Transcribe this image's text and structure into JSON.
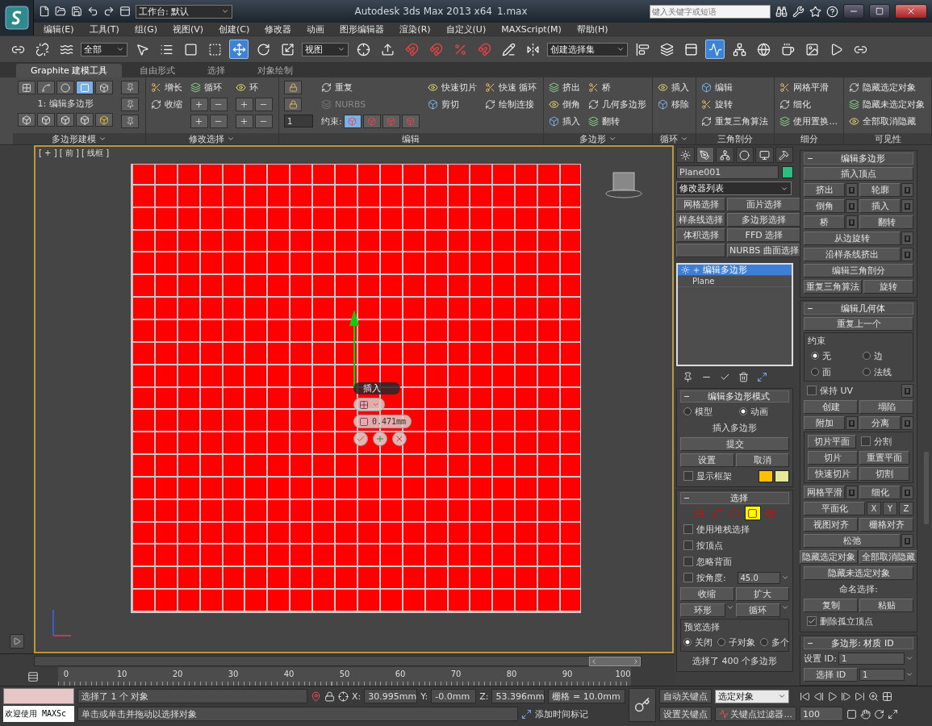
{
  "title_bar": {
    "workspace": "工作台: 默认",
    "title": "Autodesk 3ds Max  2013 x64",
    "file": "1.max",
    "search": {
      "placeholder": "键入关键字或短语"
    }
  },
  "menu": [
    "编辑(E)",
    "工具(T)",
    "组(G)",
    "视图(V)",
    "创建(C)",
    "修改器",
    "动画",
    "图形编辑器",
    "渲染(R)",
    "自定义(U)",
    "MAXScript(M)",
    "帮助(H)"
  ],
  "toolbar": [
    {
      "kind": "tool",
      "active": false
    },
    {
      "kind": "tool",
      "active": false
    },
    {
      "kind": "tool",
      "active": false
    },
    {
      "kind": "dropdown",
      "label": "全部"
    },
    {
      "kind": "tool",
      "active": false
    },
    {
      "kind": "tool",
      "active": false
    },
    {
      "kind": "tool",
      "active": false
    },
    {
      "kind": "tool",
      "active": false
    },
    {
      "kind": "tool",
      "active": true
    },
    {
      "kind": "tool",
      "active": false
    },
    {
      "kind": "tool",
      "active": false
    },
    {
      "kind": "dropdown",
      "label": "视图"
    },
    {
      "kind": "tool",
      "active": false
    },
    {
      "kind": "tool",
      "active": false
    },
    {
      "kind": "tool",
      "active": false
    },
    {
      "kind": "tool",
      "active": false
    },
    {
      "kind": "tool",
      "active": false
    },
    {
      "kind": "tool",
      "active": false
    },
    {
      "kind": "tool",
      "active": false
    },
    {
      "kind": "tool",
      "active": false
    },
    {
      "kind": "dropdown",
      "label": "创建选择集"
    },
    {
      "kind": "tool",
      "active": false
    },
    {
      "kind": "tool",
      "active": false
    },
    {
      "kind": "tool",
      "active": false
    },
    {
      "kind": "tool",
      "active": true
    },
    {
      "kind": "tool",
      "active": false
    },
    {
      "kind": "tool",
      "active": false
    },
    {
      "kind": "tool",
      "active": false
    },
    {
      "kind": "tool",
      "active": false
    },
    {
      "kind": "tool",
      "active": false
    },
    {
      "kind": "tool",
      "active": false
    }
  ],
  "ribbon": {
    "tabs": [
      {
        "label": "Graphite 建模工具",
        "selected": true
      },
      {
        "label": "自由形式",
        "selected": false
      },
      {
        "label": "选择",
        "selected": false
      },
      {
        "label": "对象绘制",
        "selected": false
      }
    ],
    "groups": [
      {
        "title": "多边形建模",
        "dropdown": true,
        "kind": "modeling",
        "caption": "1: 编辑多边形",
        "levels": [
          {
            "selected": false
          },
          {
            "selected": false
          },
          {
            "selected": false
          },
          {
            "selected": true
          },
          {
            "selected": false
          }
        ]
      },
      {
        "title": "修改选择",
        "dropdown": true,
        "kind": "items",
        "columns": [
          [
            {
              "kind": "item",
              "label": "增长",
              "disabled": false
            },
            {
              "kind": "item",
              "label": "收缩",
              "disabled": false
            }
          ],
          [
            {
              "kind": "item",
              "label": "循环",
              "disabled": false
            },
            {
              "kind": "pair"
            },
            {
              "kind": "pair"
            }
          ],
          [
            {
              "kind": "item",
              "label": "环",
              "disabled": false
            },
            {
              "kind": "pair"
            },
            {
              "kind": "pair"
            }
          ]
        ]
      },
      {
        "title": "编辑",
        "dropdown": false,
        "kind": "items",
        "columns": [
          [
            {
              "kind": "icon"
            },
            {
              "kind": "icon"
            },
            {
              "kind": "spinner",
              "label": "1"
            }
          ],
          [
            {
              "kind": "item",
              "label": "重复",
              "disabled": false
            },
            {
              "kind": "item",
              "label": "NURBS",
              "disabled": true
            },
            {
              "kind": "constraint",
              "label": "约束:"
            }
          ],
          [
            {
              "kind": "item",
              "label": "快速切片",
              "disabled": false
            },
            {
              "kind": "item",
              "label": "剪切",
              "disabled": false
            }
          ],
          [
            {
              "kind": "item",
              "label": "快速 循环",
              "disabled": false
            },
            {
              "kind": "item",
              "label": "绘制连接",
              "disabled": false
            }
          ]
        ]
      },
      {
        "title": "多边形",
        "dropdown": true,
        "kind": "items",
        "columns": [
          [
            {
              "kind": "item",
              "label": "挤出",
              "disabled": false
            },
            {
              "kind": "item",
              "label": "倒角",
              "disabled": false
            },
            {
              "kind": "item",
              "label": "插入",
              "disabled": false
            }
          ],
          [
            {
              "kind": "item",
              "label": "桥",
              "disabled": false
            },
            {
              "kind": "item",
              "label": "几何多边形",
              "disabled": false
            },
            {
              "kind": "item",
              "label": "翻转",
              "disabled": false
            }
          ]
        ]
      },
      {
        "title": "循环",
        "dropdown": true,
        "kind": "items",
        "columns": [
          [
            {
              "kind": "item",
              "label": "插入",
              "disabled": false
            },
            {
              "kind": "item",
              "label": "移除",
              "disabled": false
            }
          ]
        ]
      },
      {
        "title": "三角剖分",
        "dropdown": false,
        "kind": "items",
        "columns": [
          [
            {
              "kind": "item",
              "label": "编辑",
              "disabled": false
            },
            {
              "kind": "item",
              "label": "旋转",
              "disabled": false
            },
            {
              "kind": "item",
              "label": "重复三角算法",
              "disabled": false
            }
          ]
        ]
      },
      {
        "title": "细分",
        "dropdown": false,
        "kind": "items",
        "columns": [
          [
            {
              "kind": "item",
              "label": "网格平滑",
              "disabled": false
            },
            {
              "kind": "item",
              "label": "细化",
              "disabled": false
            },
            {
              "kind": "item",
              "label": "使用置换...",
              "disabled": false
            }
          ]
        ]
      },
      {
        "title": "可见性",
        "dropdown": false,
        "kind": "items",
        "columns": [
          [
            {
              "kind": "item",
              "label": "隐藏选定对象",
              "disabled": false
            },
            {
              "kind": "item",
              "label": "隐藏未选定对象",
              "disabled": false
            },
            {
              "kind": "item",
              "label": "全部取消隐藏",
              "disabled": false
            }
          ]
        ]
      }
    ]
  },
  "viewport": {
    "label": "[ + ] [ 前 ] [ 线框 ]",
    "caddy": {
      "title": "插入",
      "value": "0.471mm"
    }
  },
  "command_panel": {
    "tabs": [
      {
        "selected": false
      },
      {
        "selected": true
      },
      {
        "selected": false
      },
      {
        "selected": false
      },
      {
        "selected": false
      },
      {
        "selected": false
      }
    ],
    "object_name": "Plane001",
    "modifier_list": "修改器列表",
    "modifier_buttons": [
      "网格选择",
      "面片选择",
      "样条线选择",
      "多边形选择",
      "体积选择",
      "FFD 选择",
      "NURBS 曲面选择"
    ],
    "stack": [
      {
        "label": "编辑多边形",
        "selected": true,
        "kind": "modifier"
      },
      {
        "label": "Plane",
        "selected": false,
        "kind": "base"
      }
    ],
    "left_rollouts": [
      {
        "title": "编辑多边形模式",
        "rows": [
          {
            "kind": "row",
            "items": [
              {
                "kind": "radio",
                "label": "模型",
                "selected": false
              },
              {
                "kind": "radio",
                "label": "动画",
                "selected": true
              }
            ]
          },
          {
            "kind": "row",
            "items": [
              {
                "kind": "text",
                "label": "插入多边形"
              }
            ]
          },
          {
            "kind": "row",
            "items": [
              {
                "kind": "button",
                "label": "提交",
                "settings": false
              }
            ]
          },
          {
            "kind": "row",
            "items": [
              {
                "kind": "button",
                "label": "设置",
                "settings": false
              },
              {
                "kind": "button",
                "label": "取消",
                "settings": false
              }
            ]
          },
          {
            "kind": "row",
            "items": [
              {
                "kind": "checkbox",
                "label": "显示框架",
                "checked": false
              },
              {
                "kind": "swatch",
                "color": "#ffc000"
              },
              {
                "kind": "swatch",
                "color": "#e8e89a"
              }
            ]
          }
        ]
      },
      {
        "title": "选择",
        "rows": [
          {
            "kind": "row",
            "items": [
              {
                "kind": "level",
                "selected": false
              },
              {
                "kind": "level",
                "selected": false
              },
              {
                "kind": "level",
                "selected": false
              },
              {
                "kind": "level",
                "selected": true
              },
              {
                "kind": "level",
                "selected": false
              }
            ]
          },
          {
            "kind": "row",
            "items": [
              {
                "kind": "checkbox",
                "label": "使用堆栈选择",
                "checked": false
              }
            ]
          },
          {
            "kind": "row",
            "items": [
              {
                "kind": "checkbox",
                "label": "按顶点",
                "checked": false
              }
            ]
          },
          {
            "kind": "row",
            "items": [
              {
                "kind": "checkbox",
                "label": "忽略背面",
                "checked": false
              }
            ]
          },
          {
            "kind": "row",
            "items": [
              {
                "kind": "checkbox",
                "label": "按角度:",
                "checked": false
              },
              {
                "kind": "spinner",
                "value": "45.0"
              }
            ]
          },
          {
            "kind": "row",
            "items": [
              {
                "kind": "button",
                "label": "收缩",
                "settings": false
              },
              {
                "kind": "button",
                "label": "扩大",
                "settings": false
              }
            ]
          },
          {
            "kind": "row",
            "items": [
              {
                "kind": "spinbutton",
                "label": "环形"
              },
              {
                "kind": "spinbutton",
                "label": "循环"
              }
            ]
          },
          {
            "kind": "group",
            "title": "预览选择",
            "rows": [
              {
                "kind": "row",
                "items": [
                  {
                    "kind": "radio",
                    "label": "关闭",
                    "selected": true
                  },
                  {
                    "kind": "radio",
                    "label": "子对象",
                    "selected": false
                  },
                  {
                    "kind": "radio",
                    "label": "多个",
                    "selected": false
                  }
                ]
              }
            ]
          },
          {
            "kind": "row",
            "items": [
              {
                "kind": "text",
                "label": "选择了 400 个多边形"
              }
            ]
          }
        ]
      }
    ],
    "right_rollouts": [
      {
        "title": "编辑多边形",
        "rows": [
          {
            "kind": "row",
            "items": [
              {
                "kind": "button",
                "label": "插入顶点",
                "settings": false
              }
            ]
          },
          {
            "kind": "row",
            "items": [
              {
                "kind": "button",
                "label": "挤出",
                "settings": true
              },
              {
                "kind": "button",
                "label": "轮廓",
                "settings": true
              }
            ]
          },
          {
            "kind": "row",
            "items": [
              {
                "kind": "button",
                "label": "倒角",
                "settings": true
              },
              {
                "kind": "button",
                "label": "插入",
                "settings": true
              }
            ]
          },
          {
            "kind": "row",
            "items": [
              {
                "kind": "button",
                "label": "桥",
                "settings": true
              },
              {
                "kind": "button",
                "label": "翻转",
                "settings": false
              }
            ]
          },
          {
            "kind": "row",
            "items": [
              {
                "kind": "button",
                "label": "从边旋转",
                "settings": true
              }
            ]
          },
          {
            "kind": "row",
            "items": [
              {
                "kind": "button",
                "label": "沿样条线挤出",
                "settings": true
              }
            ]
          },
          {
            "kind": "row",
            "items": [
              {
                "kind": "button",
                "label": "编辑三角剖分",
                "settings": false
              }
            ]
          },
          {
            "kind": "row",
            "items": [
              {
                "kind": "button",
                "label": "重复三角算法",
                "settings": false
              },
              {
                "kind": "button",
                "label": "旋转",
                "settings": false
              }
            ]
          }
        ]
      },
      {
        "title": "编辑几何体",
        "rows": [
          {
            "kind": "row",
            "items": [
              {
                "kind": "button",
                "label": "重复上一个",
                "settings": false
              }
            ]
          },
          {
            "kind": "group",
            "title": "约束",
            "rows": [
              {
                "kind": "row",
                "items": [
                  {
                    "kind": "radio",
                    "label": "无",
                    "selected": true
                  },
                  {
                    "kind": "radio",
                    "label": "边",
                    "selected": false
                  }
                ]
              },
              {
                "kind": "row",
                "items": [
                  {
                    "kind": "radio",
                    "label": "面",
                    "selected": false
                  },
                  {
                    "kind": "radio",
                    "label": "法线",
                    "selected": false
                  }
                ]
              }
            ]
          },
          {
            "kind": "row",
            "items": [
              {
                "kind": "checkbox",
                "label": "保持 UV",
                "checked": false
              },
              {
                "kind": "settings"
              }
            ]
          },
          {
            "kind": "row",
            "items": [
              {
                "kind": "button",
                "label": "创建",
                "settings": false
              },
              {
                "kind": "button",
                "label": "塌陷",
                "settings": false
              }
            ]
          },
          {
            "kind": "row",
            "items": [
              {
                "kind": "button",
                "label": "附加",
                "settings": true
              },
              {
                "kind": "button",
                "label": "分离",
                "settings": true
              }
            ]
          },
          {
            "kind": "frame",
            "rows": [
              {
                "kind": "row",
                "items": [
                  {
                    "kind": "button",
                    "label": "切片平面",
                    "settings": false
                  },
                  {
                    "kind": "checkbox",
                    "label": "分割",
                    "checked": false
                  }
                ]
              },
              {
                "kind": "row",
                "items": [
                  {
                    "kind": "button",
                    "label": "切片",
                    "settings": false
                  },
                  {
                    "kind": "button",
                    "label": "重置平面",
                    "settings": false
                  }
                ]
              },
              {
                "kind": "row",
                "items": [
                  {
                    "kind": "button",
                    "label": "快速切片",
                    "settings": false
                  },
                  {
                    "kind": "button",
                    "label": "切割",
                    "settings": false
                  }
                ]
              }
            ]
          },
          {
            "kind": "row",
            "items": [
              {
                "kind": "button",
                "label": "网格平滑",
                "settings": true
              },
              {
                "kind": "button",
                "label": "细化",
                "settings": true
              }
            ]
          },
          {
            "kind": "row",
            "items": [
              {
                "kind": "button",
                "label": "平面化",
                "settings": false
              },
              {
                "kind": "axis",
                "label": "X"
              },
              {
                "kind": "axis",
                "label": "Y"
              },
              {
                "kind": "axis",
                "label": "Z"
              }
            ]
          },
          {
            "kind": "row",
            "items": [
              {
                "kind": "button",
                "label": "视图对齐",
                "settings": false
              },
              {
                "kind": "button",
                "label": "栅格对齐",
                "settings": false
              }
            ]
          },
          {
            "kind": "row",
            "items": [
              {
                "kind": "button",
                "label": "松弛",
                "settings": true
              }
            ]
          },
          {
            "kind": "row",
            "items": [
              {
                "kind": "button",
                "label": "隐藏选定对象",
                "settings": false
              },
              {
                "kind": "button",
                "label": "全部取消隐藏",
                "settings": false
              }
            ]
          },
          {
            "kind": "row",
            "items": [
              {
                "kind": "button",
                "label": "隐藏未选定对象",
                "settings": false
              }
            ]
          },
          {
            "kind": "row",
            "items": [
              {
                "kind": "text",
                "label": "命名选择:"
              }
            ]
          },
          {
            "kind": "row",
            "items": [
              {
                "kind": "button",
                "label": "复制",
                "settings": false
              },
              {
                "kind": "button",
                "label": "粘贴",
                "settings": false
              }
            ]
          },
          {
            "kind": "row",
            "items": [
              {
                "kind": "checkbox",
                "label": "删除孤立顶点",
                "checked": true
              }
            ]
          }
        ]
      },
      {
        "title": "多边形: 材质 ID",
        "rows": [
          {
            "kind": "row",
            "items": [
              {
                "kind": "text",
                "label": "设置 ID:"
              },
              {
                "kind": "spinner",
                "value": "1"
              }
            ]
          },
          {
            "kind": "row",
            "items": [
              {
                "kind": "button",
                "label": "选择 ID",
                "settings": false
              },
              {
                "kind": "spinner",
                "value": "1"
              }
            ]
          }
        ]
      }
    ]
  },
  "timeline": {
    "slider": {
      "level": 1
    },
    "ticks": [
      "0",
      "10",
      "20",
      "30",
      "40",
      "50",
      "60",
      "70",
      "80",
      "90",
      "100"
    ]
  },
  "status_bar": {
    "listener": "欢迎使用 MAXSc",
    "prompt": "选择了 1 个 对象",
    "hint": "单击或单击并拖动以选择对象",
    "coords": [
      {
        "label": "X:",
        "value": "30.995mm"
      },
      {
        "label": "Y:",
        "value": "-0.0mm"
      },
      {
        "label": "Z:",
        "value": "53.396mm"
      }
    ],
    "grid": "栅格 = 10.0mm",
    "time_tag": "添加时间标记",
    "auto_key": "自动关键点",
    "set_key": "设置关键点",
    "key_mode": "选定对象",
    "key_filters": "关键点过滤器...",
    "frame": "100"
  }
}
